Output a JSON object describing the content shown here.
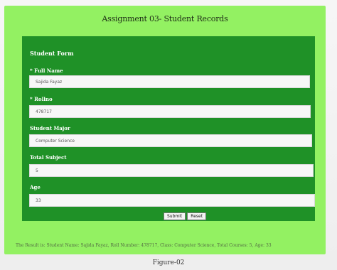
{
  "page": {
    "title": "Assignment 03- Student Records",
    "caption": "Figure-02"
  },
  "form": {
    "title": "Student Form",
    "fields": [
      {
        "label": "* Full Name",
        "value": "Sajida Fayaz"
      },
      {
        "label": "* Rollno",
        "value": "478717"
      },
      {
        "label": "Student Major",
        "value": "Computer Science"
      },
      {
        "label": "Total Subject",
        "value": "5"
      },
      {
        "label": "Age",
        "value": "33"
      }
    ],
    "buttons": {
      "submit": "Submit",
      "reset": "Reset"
    }
  },
  "result": {
    "text": "The Result is: Student Name: Sajida Fayaz, Roll Number: 478717, Class: Computer Science, Total Courses: 5, Age: 33"
  },
  "colors": {
    "panel": "#93f162",
    "form": "#1f9127"
  }
}
